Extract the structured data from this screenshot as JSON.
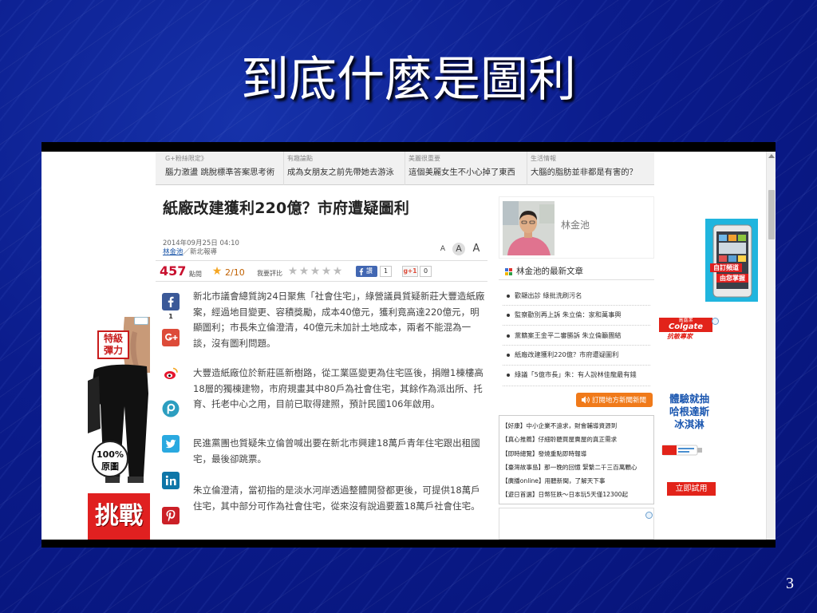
{
  "slide": {
    "title": "到底什麼是圖利",
    "page_number": "3"
  },
  "web": {
    "top_nav": [
      {
        "category": "G+粉絲限定》",
        "headline": "腦力激盪 跳脫標準答案思考術"
      },
      {
        "category": "有趣論點",
        "headline": "成為女朋友之前先帶她去游泳"
      },
      {
        "category": "美麗很重要",
        "headline": "這個美麗女生不小心掉了東西"
      },
      {
        "category": "生活情報",
        "headline": "大腦的脂肪並非都是有害的？"
      }
    ],
    "article": {
      "title": "紙廠改建獲利220億？市府遭疑圖利",
      "date": "2014年09月25日 04:10",
      "author": "林金池",
      "byline_suffix": "／新北報導",
      "font_size_controls": [
        "A",
        "A",
        "A"
      ],
      "views": "457",
      "views_label": "點閱",
      "rating": "2/10",
      "rate_label": "我要評比",
      "facebook_like_label": "讚",
      "facebook_like_count": "1",
      "gplus_label": "g+1",
      "gplus_count": "0",
      "paragraphs": [
        "新北市議會總質詢24日聚焦「社會住宅」，綠營議員質疑新莊大豐造紙廠案，經過地目變更、容積獎勵，成本40億元，獲利竟高達220億元，明顯圖利；市長朱立倫澄清，40億元未加計土地成本，兩者不能混為一談，沒有圖利問題。",
        "大豐造紙廠位於新莊區新樹路，從工業區變更為住宅區後，捐贈1棟樓高18層的獨棟建物，市府規畫其中80戶為社會住宅，其餘作為派出所、托育、托老中心之用，目前已取得建照，預計民國106年啟用。",
        "民進黨團也質疑朱立倫曾喊出要在新北市興建18萬戶青年住宅跟出租國宅，最後卻跳票。",
        "朱立倫澄清，當初指的是淡水河岸透過整體開發都更後，可提供18萬戶住宅，其中部分可作為社會住宅，從來沒有說過要蓋18萬戶社會住宅。"
      ]
    },
    "share_bar": {
      "facebook_count": "1",
      "icons": [
        "facebook-icon",
        "google-plus-icon",
        "weibo-icon",
        "plurk-icon",
        "twitter-icon",
        "linkedin-icon",
        "pinterest-icon"
      ]
    },
    "sidebar": {
      "author_name": "林金池",
      "latest_heading": "林金池的最新文章",
      "latest_articles": [
        "歡顯出診 綠批洗刷污名",
        "監察勸別再上訴 朱立倫：家和萬事興",
        "黨籍案王金平二審勝訴 朱立倫籲團結",
        "紙廠改建獲利220億？市府遭疑圖利",
        "綠議「5億市長」朱：有人說林佳龍最有錢"
      ],
      "subscribe_label": "訂閱地方新聞新聞",
      "promo_links": [
        "【好康】中小企業不遠求，財會輔導資源到",
        "【真心推薦】仔細聆聽買屋賣屋的真正需求",
        "【即時總覽】發燒重點即時報導",
        "【臺灣故事島】那一晚的回憶 緊繫二千三百萬顆心",
        "【廣播online】用聽新聞，了解天下事",
        "【遊日首選】日幣狂跌～日本玩5天僅12300起"
      ]
    },
    "ads": {
      "left_ad": {
        "badge": "特級彈力",
        "stamp_top": "100%",
        "stamp_bottom": "原圖",
        "banner": "挑戰"
      },
      "phone_ad": {
        "line1": "自訂頻道",
        "line2": "由您掌握"
      },
      "colgate_ad": {
        "brand_cn": "高露潔",
        "brand": "Colgate",
        "tagline": "抗敏專家",
        "headline": [
          "體驗就抽",
          "哈根達斯",
          "冰淇淋"
        ],
        "cta": "立即試用"
      }
    },
    "colors": {
      "slide_background": "#0b1c8c",
      "views_count": "#c8102e",
      "subscribe_button": "#f07a1a",
      "colgate_red": "#e2231a",
      "ad_headline_blue": "#1b57b0"
    }
  }
}
